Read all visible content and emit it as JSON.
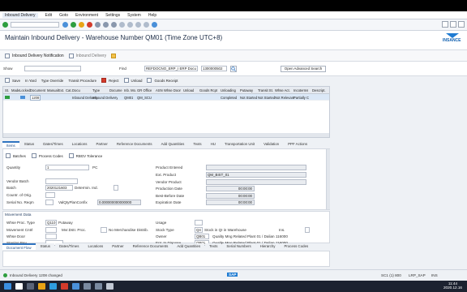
{
  "menu": [
    "Inbound Delivery",
    "Edit",
    "Goto",
    "Environment",
    "Settings",
    "System",
    "Help"
  ],
  "title": "Maintain Inbound Delivery - Warehouse Number QM01 (Time Zone UTC+8)",
  "logo": "INSANCE",
  "appbar": {
    "notification": "Inbound Delivery Notification",
    "delivery": "Inbound Delivery"
  },
  "show": {
    "label": "Show",
    "find_label": "Find",
    "find_select": "REFDOCNO_ERP_I ERP Docu",
    "find_value": "1300000502",
    "advanced": "Open Advanced Search"
  },
  "actions": [
    "Save",
    "In Yard",
    "Type Override",
    "Transit Procedure",
    "Reject",
    "Unload",
    "Goods Receipt"
  ],
  "grid": {
    "headers": [
      "St.",
      "Made",
      "Locked",
      "Document",
      "Manual",
      "Ext.",
      "Cat.",
      "Docu",
      "Type",
      "Docume",
      "Inb. Mo.",
      "GR Office",
      "ASN",
      "Whse Door",
      "Unload",
      "Goods Rcpt",
      "Unloading",
      "Putaway",
      "Transit St.",
      "Whse Act.",
      "Incoterms",
      "Descript."
    ],
    "row": [
      "",
      "",
      "",
      "1208",
      "",
      "",
      "",
      "Inbound Delivery",
      "Inbound Delivery",
      "",
      "QM01",
      "QM_SCU",
      "",
      "",
      "",
      "",
      "Completed",
      "Not Started",
      "Not Started",
      "Not Relevant",
      "Partially C",
      ""
    ]
  },
  "tabs1": [
    "Items",
    "Status",
    "Dates/Times",
    "Locations",
    "Partner",
    "Reference Documents",
    "Add Quantities",
    "Texts",
    "HU",
    "Transportation Unit",
    "Validation",
    "PPF Actions"
  ],
  "subactions": [
    "Batches",
    "Process Codes",
    "RBGV Tolerance"
  ],
  "left_fields": [
    {
      "label": "Quantity",
      "value": "1",
      "unit": "PC"
    },
    {
      "label": "Vendor Batch",
      "value": ""
    },
    {
      "label": "Batch",
      "value": "2020121603",
      "extra": "Determin. Ind."
    },
    {
      "label": "Countr. of Orig.",
      "value": ""
    },
    {
      "label": "Serial No. Reqm",
      "value": "",
      "extra2": "ValQtyPlanConfix",
      "extra2_val": "0.000000000000000"
    }
  ],
  "right_fields": [
    {
      "label": "Product Entered",
      "value": ""
    },
    {
      "label": "Ext. Product",
      "value": "QM_BIST_01"
    },
    {
      "label": "Vendor Product",
      "value": ""
    },
    {
      "label": "Production Date",
      "value": "00:00:00"
    },
    {
      "label": "Best-Before Date",
      "value": "00:00:00"
    },
    {
      "label": "Expiration Date",
      "value": "00:00:00"
    }
  ],
  "movement": {
    "section": "Movement Data",
    "left": [
      {
        "label": "Whse Proc. Type",
        "value": "Q110",
        "desc": "Putaway"
      },
      {
        "label": "Movement Cntrl",
        "value": "",
        "desc": "Mvr.Dstr. Proc.",
        "desc2": "No Merchandise Distrib."
      },
      {
        "label": "Whse Door",
        "value": ""
      },
      {
        "label": "Staging Bay",
        "value": ""
      }
    ],
    "right": [
      {
        "label": "Usage",
        "value": ""
      },
      {
        "label": "Stock Type",
        "value": "Q4",
        "desc": "Stock in QI in Warehouse",
        "desc2": "Ins."
      },
      {
        "label": "Owner",
        "value": "QB01",
        "desc": "Quality Mng Related Plant 01 / Dalian 116000"
      },
      {
        "label": "Ent. to Dispose",
        "value": "QB01",
        "desc": "Quality Mng Related Plant 01 / Dalian 116000"
      }
    ]
  },
  "tabs2": [
    "Document Flow",
    "Status",
    "Dates/Times",
    "Locations",
    "Partner",
    "Reference Documents",
    "Add Quantities",
    "Texts",
    "Serial Numbers",
    "Hierarchy",
    "Process Codes"
  ],
  "status": {
    "message": "Inbound Delivery 1208 changed",
    "brand": "SAP",
    "session": "SC1 (1) 800",
    "user": "LRP_SAP",
    "mode": "INS"
  },
  "clock": {
    "time": "11:44",
    "date": "2020.12.16"
  },
  "colors": {
    "accent": "#2f74c0",
    "ok": "#2e9e3f",
    "warn": "#e8a415",
    "err": "#d33b2b"
  }
}
